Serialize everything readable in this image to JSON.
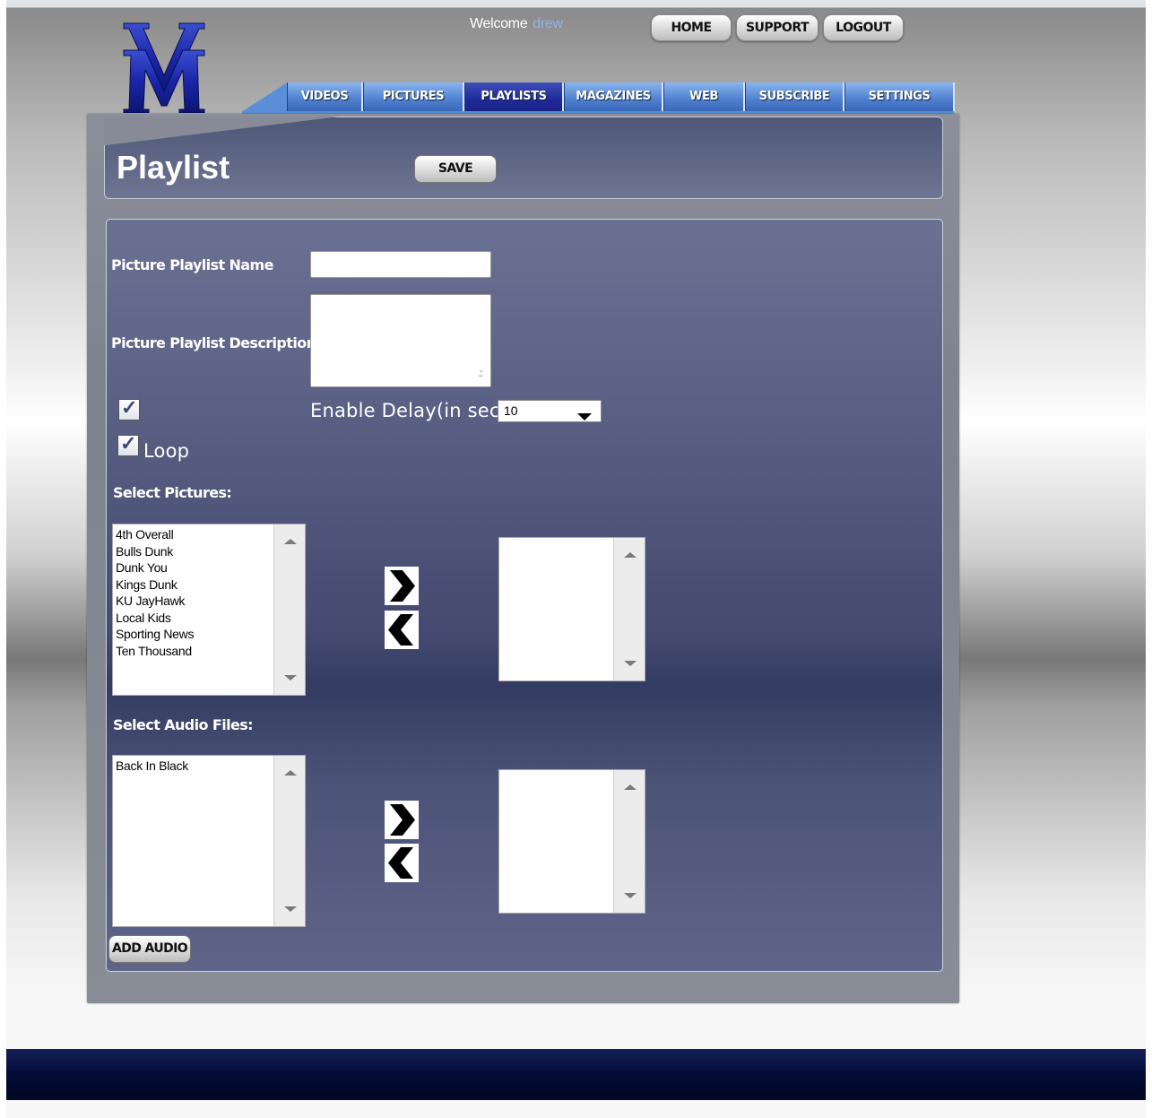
{
  "brand": {
    "logo_text": "VM"
  },
  "header": {
    "welcome_label": "Welcome",
    "username": "drew"
  },
  "top_nav": {
    "home": "HOME",
    "support": "SUPPORT",
    "logout": "LOGOUT"
  },
  "tabs": [
    {
      "label": "VIDEOS"
    },
    {
      "label": "PICTURES"
    },
    {
      "label": "PLAYLISTS",
      "active": true
    },
    {
      "label": "MAGAZINES"
    },
    {
      "label": "WEB"
    },
    {
      "label": "SUBSCRIBE"
    },
    {
      "label": "SETTINGS"
    }
  ],
  "page": {
    "title": "Playlist",
    "save_label": "SAVE"
  },
  "form": {
    "name_label": "Picture Playlist Name",
    "name_value": "",
    "description_label": "Picture Playlist Description",
    "description_value": "",
    "enable_delay_checked": true,
    "enable_delay_label": "Enable Delay(in sec)",
    "delay_value": "10",
    "loop_checked": true,
    "loop_label": "Loop",
    "select_pictures_label": "Select Pictures:",
    "pictures_available": [
      "4th Overall",
      "Bulls Dunk",
      "Dunk You",
      "Kings Dunk",
      "KU JayHawk",
      "Local Kids",
      "Sporting News",
      "Ten Thousand"
    ],
    "pictures_selected": [],
    "select_audio_label": "Select Audio Files:",
    "audio_available": [
      "Back In Black"
    ],
    "audio_selected": [],
    "add_audio_label": "ADD AUDIO"
  },
  "colors": {
    "tab_blue": "#5a8fd8",
    "tab_active": "#1f2a98",
    "footer_navy": "#030a36",
    "username_blue": "#8fb4e8"
  },
  "icons": {
    "move_right": "chevron-right-icon",
    "move_left": "chevron-left-icon",
    "checkbox": "checkmark-icon",
    "dropdown": "caret-down-icon"
  }
}
